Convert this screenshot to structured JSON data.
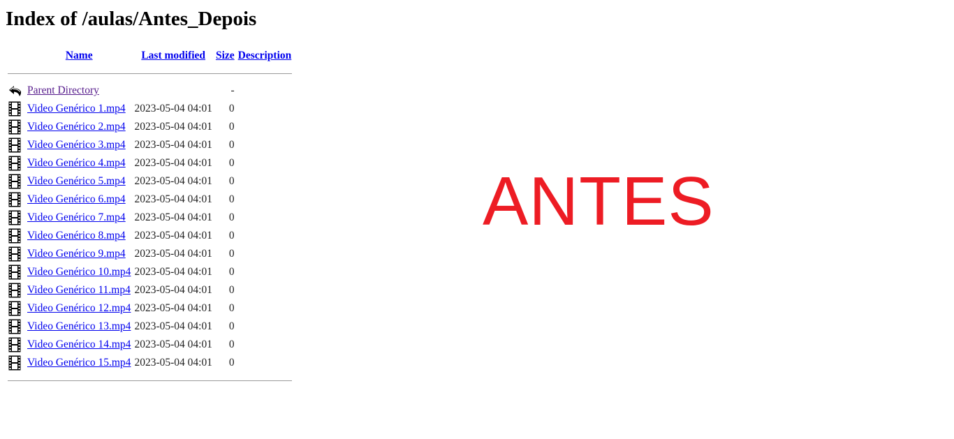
{
  "title": "Index of /aulas/Antes_Depois",
  "columns": {
    "name": "Name",
    "last_modified": "Last modified",
    "size": "Size",
    "description": "Description"
  },
  "parent": {
    "icon": "back-arrow-icon",
    "label": "Parent Directory",
    "size": "-"
  },
  "files": [
    {
      "icon": "film-icon",
      "name": "Video Genérico 1.mp4",
      "modified": "2023-05-04 04:01",
      "size": "0"
    },
    {
      "icon": "film-icon",
      "name": "Video Genérico 2.mp4",
      "modified": "2023-05-04 04:01",
      "size": "0"
    },
    {
      "icon": "film-icon",
      "name": "Video Genérico 3.mp4",
      "modified": "2023-05-04 04:01",
      "size": "0"
    },
    {
      "icon": "film-icon",
      "name": "Video Genérico 4.mp4",
      "modified": "2023-05-04 04:01",
      "size": "0"
    },
    {
      "icon": "film-icon",
      "name": "Video Genérico 5.mp4",
      "modified": "2023-05-04 04:01",
      "size": "0"
    },
    {
      "icon": "film-icon",
      "name": "Video Genérico 6.mp4",
      "modified": "2023-05-04 04:01",
      "size": "0"
    },
    {
      "icon": "film-icon",
      "name": "Video Genérico 7.mp4",
      "modified": "2023-05-04 04:01",
      "size": "0"
    },
    {
      "icon": "film-icon",
      "name": "Video Genérico 8.mp4",
      "modified": "2023-05-04 04:01",
      "size": "0"
    },
    {
      "icon": "film-icon",
      "name": "Video Genérico 9.mp4",
      "modified": "2023-05-04 04:01",
      "size": "0"
    },
    {
      "icon": "film-icon",
      "name": "Video Genérico 10.mp4",
      "modified": "2023-05-04 04:01",
      "size": "0"
    },
    {
      "icon": "film-icon",
      "name": "Video Genérico 11.mp4",
      "modified": "2023-05-04 04:01",
      "size": "0"
    },
    {
      "icon": "film-icon",
      "name": "Video Genérico 12.mp4",
      "modified": "2023-05-04 04:01",
      "size": "0"
    },
    {
      "icon": "film-icon",
      "name": "Video Genérico 13.mp4",
      "modified": "2023-05-04 04:01",
      "size": "0"
    },
    {
      "icon": "film-icon",
      "name": "Video Genérico 14.mp4",
      "modified": "2023-05-04 04:01",
      "size": "0"
    },
    {
      "icon": "film-icon",
      "name": "Video Genérico 15.mp4",
      "modified": "2023-05-04 04:01",
      "size": "0"
    }
  ],
  "overlay_text": "ANTES",
  "colors": {
    "link": "#0000ee",
    "visited_link": "#551a8b",
    "overlay": "#ed1c24",
    "rule": "#9a9a9a"
  }
}
